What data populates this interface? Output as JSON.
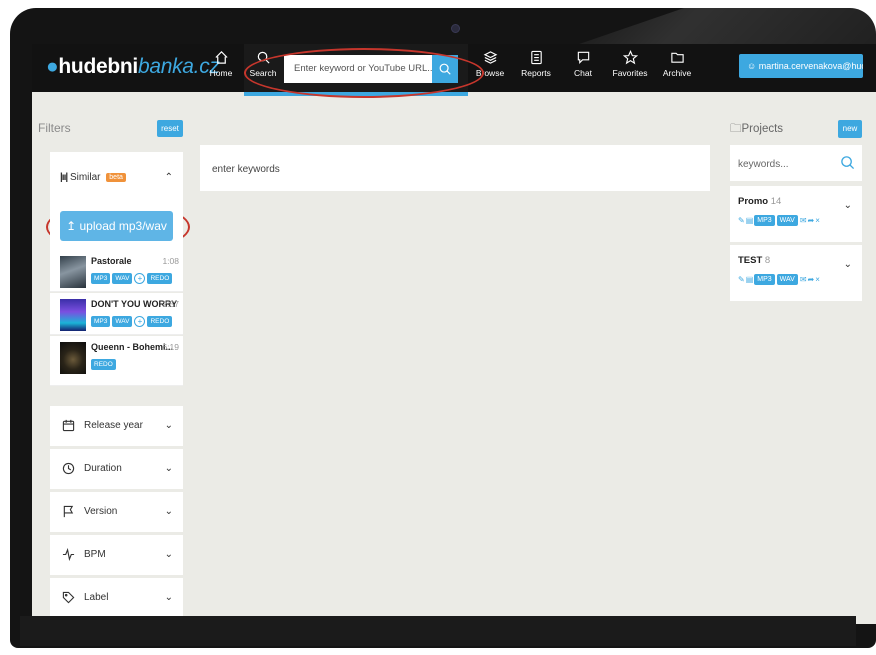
{
  "header": {
    "logo_bold": "hudebni",
    "logo_italic": "banka",
    "logo_tld": ".cz",
    "nav": [
      {
        "label": "Home",
        "icon": "home-icon"
      },
      {
        "label": "Search",
        "icon": "search-icon"
      },
      {
        "label": "Browse",
        "icon": "layers-icon"
      },
      {
        "label": "Reports",
        "icon": "report-icon"
      },
      {
        "label": "Chat",
        "icon": "chat-icon"
      },
      {
        "label": "Favorites",
        "icon": "star-icon"
      },
      {
        "label": "Archive",
        "icon": "folder-icon"
      }
    ],
    "search_placeholder": "Enter keyword or YouTube URL...",
    "user": "martina.cervenakova@hude..."
  },
  "filters": {
    "title": "Filters",
    "reset": "reset",
    "similar": {
      "label": "Similar",
      "badge": "beta"
    },
    "upload": "upload mp3/wav",
    "tracks": [
      {
        "title": "Pastorale",
        "duration": "1:08",
        "badges": [
          "MP3",
          "WAV",
          "REDO"
        ],
        "has_add": true
      },
      {
        "title": "DON'T YOU WORRY",
        "duration": "2:57",
        "badges": [
          "MP3",
          "WAV",
          "REDO"
        ],
        "has_add": true
      },
      {
        "title": "Queenn - Bohemi...",
        "duration": "6:19",
        "badges": [
          "REDO"
        ],
        "has_add": false
      }
    ],
    "rows": [
      {
        "label": "Release year",
        "icon": "calendar-icon"
      },
      {
        "label": "Duration",
        "icon": "clock-icon"
      },
      {
        "label": "Version",
        "icon": "flag-icon"
      },
      {
        "label": "BPM",
        "icon": "pulse-icon"
      },
      {
        "label": "Label",
        "icon": "tag-icon"
      }
    ]
  },
  "main": {
    "keywords_placeholder": "enter keywords"
  },
  "projects": {
    "title": "Projects",
    "new": "new",
    "search_placeholder": "keywords...",
    "items": [
      {
        "name": "Promo",
        "count": "14",
        "badges": [
          "MP3",
          "WAV"
        ]
      },
      {
        "name": "TEST",
        "count": "8",
        "badges": [
          "MP3",
          "WAV"
        ]
      }
    ]
  },
  "colors": {
    "accent": "#3da8e0",
    "topbar": "#121212",
    "background": "#ebebe6",
    "beta": "#f0923a",
    "annotation": "#c6362c"
  }
}
